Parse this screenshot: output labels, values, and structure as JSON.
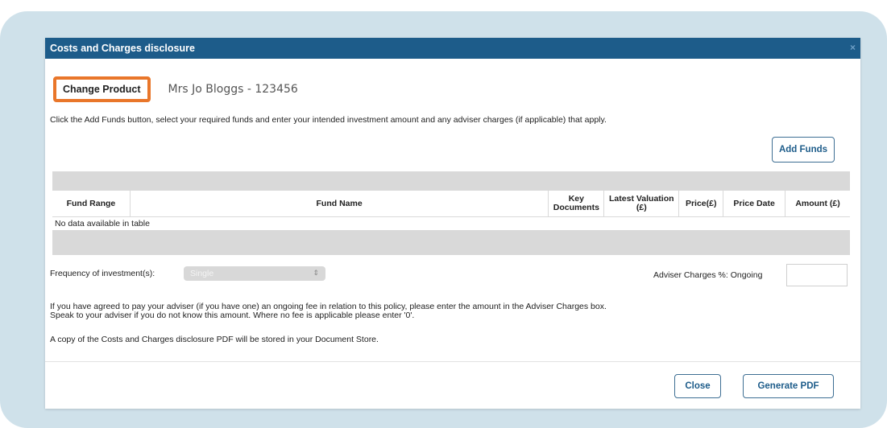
{
  "dialog": {
    "title": "Costs and Charges disclosure",
    "close_glyph": "×"
  },
  "product": {
    "change_button": "Change Product",
    "client": "Mrs Jo Bloggs - 123456"
  },
  "instruction": "Click the Add Funds button, select your required funds and enter your intended investment amount and any adviser charges (if applicable) that apply.",
  "add_funds_button": "Add Funds",
  "table": {
    "headers": [
      "Fund Range",
      "Fund Name",
      "Key Documents",
      "Latest Valuation (£)",
      "Price(£)",
      "Price Date",
      "Amount (£)"
    ],
    "empty_message": "No data available in table"
  },
  "frequency": {
    "label": "Frequency of investment(s):",
    "selected": "Single"
  },
  "adviser_charges": {
    "label": "Adviser Charges %: Ongoing",
    "value": ""
  },
  "notes": {
    "line1": "If you have agreed to pay your adviser (if you have one) an ongoing fee in relation to this policy, please enter the amount in the Adviser Charges box.",
    "line2": "Speak to your adviser if you do not know this amount. Where no fee is applicable please enter '0'.",
    "line3": "A copy of the Costs and Charges disclosure PDF will be stored in your Document Store."
  },
  "footer": {
    "close_button": "Close",
    "generate_button": "Generate PDF"
  },
  "colors": {
    "titlebar": "#1d5c8a",
    "highlight": "#e9762a",
    "frame": "#cfe1ea"
  }
}
